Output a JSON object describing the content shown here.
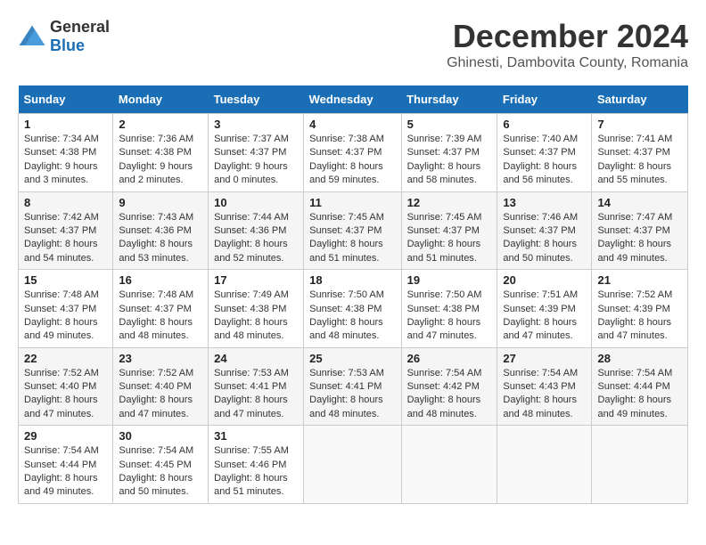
{
  "header": {
    "logo_general": "General",
    "logo_blue": "Blue",
    "main_title": "December 2024",
    "subtitle": "Ghinesti, Dambovita County, Romania"
  },
  "calendar": {
    "headers": [
      "Sunday",
      "Monday",
      "Tuesday",
      "Wednesday",
      "Thursday",
      "Friday",
      "Saturday"
    ],
    "rows": [
      [
        {
          "day": "1",
          "sunrise": "Sunrise: 7:34 AM",
          "sunset": "Sunset: 4:38 PM",
          "daylight": "Daylight: 9 hours and 3 minutes."
        },
        {
          "day": "2",
          "sunrise": "Sunrise: 7:36 AM",
          "sunset": "Sunset: 4:38 PM",
          "daylight": "Daylight: 9 hours and 2 minutes."
        },
        {
          "day": "3",
          "sunrise": "Sunrise: 7:37 AM",
          "sunset": "Sunset: 4:37 PM",
          "daylight": "Daylight: 9 hours and 0 minutes."
        },
        {
          "day": "4",
          "sunrise": "Sunrise: 7:38 AM",
          "sunset": "Sunset: 4:37 PM",
          "daylight": "Daylight: 8 hours and 59 minutes."
        },
        {
          "day": "5",
          "sunrise": "Sunrise: 7:39 AM",
          "sunset": "Sunset: 4:37 PM",
          "daylight": "Daylight: 8 hours and 58 minutes."
        },
        {
          "day": "6",
          "sunrise": "Sunrise: 7:40 AM",
          "sunset": "Sunset: 4:37 PM",
          "daylight": "Daylight: 8 hours and 56 minutes."
        },
        {
          "day": "7",
          "sunrise": "Sunrise: 7:41 AM",
          "sunset": "Sunset: 4:37 PM",
          "daylight": "Daylight: 8 hours and 55 minutes."
        }
      ],
      [
        {
          "day": "8",
          "sunrise": "Sunrise: 7:42 AM",
          "sunset": "Sunset: 4:37 PM",
          "daylight": "Daylight: 8 hours and 54 minutes."
        },
        {
          "day": "9",
          "sunrise": "Sunrise: 7:43 AM",
          "sunset": "Sunset: 4:36 PM",
          "daylight": "Daylight: 8 hours and 53 minutes."
        },
        {
          "day": "10",
          "sunrise": "Sunrise: 7:44 AM",
          "sunset": "Sunset: 4:36 PM",
          "daylight": "Daylight: 8 hours and 52 minutes."
        },
        {
          "day": "11",
          "sunrise": "Sunrise: 7:45 AM",
          "sunset": "Sunset: 4:37 PM",
          "daylight": "Daylight: 8 hours and 51 minutes."
        },
        {
          "day": "12",
          "sunrise": "Sunrise: 7:45 AM",
          "sunset": "Sunset: 4:37 PM",
          "daylight": "Daylight: 8 hours and 51 minutes."
        },
        {
          "day": "13",
          "sunrise": "Sunrise: 7:46 AM",
          "sunset": "Sunset: 4:37 PM",
          "daylight": "Daylight: 8 hours and 50 minutes."
        },
        {
          "day": "14",
          "sunrise": "Sunrise: 7:47 AM",
          "sunset": "Sunset: 4:37 PM",
          "daylight": "Daylight: 8 hours and 49 minutes."
        }
      ],
      [
        {
          "day": "15",
          "sunrise": "Sunrise: 7:48 AM",
          "sunset": "Sunset: 4:37 PM",
          "daylight": "Daylight: 8 hours and 49 minutes."
        },
        {
          "day": "16",
          "sunrise": "Sunrise: 7:48 AM",
          "sunset": "Sunset: 4:37 PM",
          "daylight": "Daylight: 8 hours and 48 minutes."
        },
        {
          "day": "17",
          "sunrise": "Sunrise: 7:49 AM",
          "sunset": "Sunset: 4:38 PM",
          "daylight": "Daylight: 8 hours and 48 minutes."
        },
        {
          "day": "18",
          "sunrise": "Sunrise: 7:50 AM",
          "sunset": "Sunset: 4:38 PM",
          "daylight": "Daylight: 8 hours and 48 minutes."
        },
        {
          "day": "19",
          "sunrise": "Sunrise: 7:50 AM",
          "sunset": "Sunset: 4:38 PM",
          "daylight": "Daylight: 8 hours and 47 minutes."
        },
        {
          "day": "20",
          "sunrise": "Sunrise: 7:51 AM",
          "sunset": "Sunset: 4:39 PM",
          "daylight": "Daylight: 8 hours and 47 minutes."
        },
        {
          "day": "21",
          "sunrise": "Sunrise: 7:52 AM",
          "sunset": "Sunset: 4:39 PM",
          "daylight": "Daylight: 8 hours and 47 minutes."
        }
      ],
      [
        {
          "day": "22",
          "sunrise": "Sunrise: 7:52 AM",
          "sunset": "Sunset: 4:40 PM",
          "daylight": "Daylight: 8 hours and 47 minutes."
        },
        {
          "day": "23",
          "sunrise": "Sunrise: 7:52 AM",
          "sunset": "Sunset: 4:40 PM",
          "daylight": "Daylight: 8 hours and 47 minutes."
        },
        {
          "day": "24",
          "sunrise": "Sunrise: 7:53 AM",
          "sunset": "Sunset: 4:41 PM",
          "daylight": "Daylight: 8 hours and 47 minutes."
        },
        {
          "day": "25",
          "sunrise": "Sunrise: 7:53 AM",
          "sunset": "Sunset: 4:41 PM",
          "daylight": "Daylight: 8 hours and 48 minutes."
        },
        {
          "day": "26",
          "sunrise": "Sunrise: 7:54 AM",
          "sunset": "Sunset: 4:42 PM",
          "daylight": "Daylight: 8 hours and 48 minutes."
        },
        {
          "day": "27",
          "sunrise": "Sunrise: 7:54 AM",
          "sunset": "Sunset: 4:43 PM",
          "daylight": "Daylight: 8 hours and 48 minutes."
        },
        {
          "day": "28",
          "sunrise": "Sunrise: 7:54 AM",
          "sunset": "Sunset: 4:44 PM",
          "daylight": "Daylight: 8 hours and 49 minutes."
        }
      ],
      [
        {
          "day": "29",
          "sunrise": "Sunrise: 7:54 AM",
          "sunset": "Sunset: 4:44 PM",
          "daylight": "Daylight: 8 hours and 49 minutes."
        },
        {
          "day": "30",
          "sunrise": "Sunrise: 7:54 AM",
          "sunset": "Sunset: 4:45 PM",
          "daylight": "Daylight: 8 hours and 50 minutes."
        },
        {
          "day": "31",
          "sunrise": "Sunrise: 7:55 AM",
          "sunset": "Sunset: 4:46 PM",
          "daylight": "Daylight: 8 hours and 51 minutes."
        },
        null,
        null,
        null,
        null
      ]
    ]
  }
}
